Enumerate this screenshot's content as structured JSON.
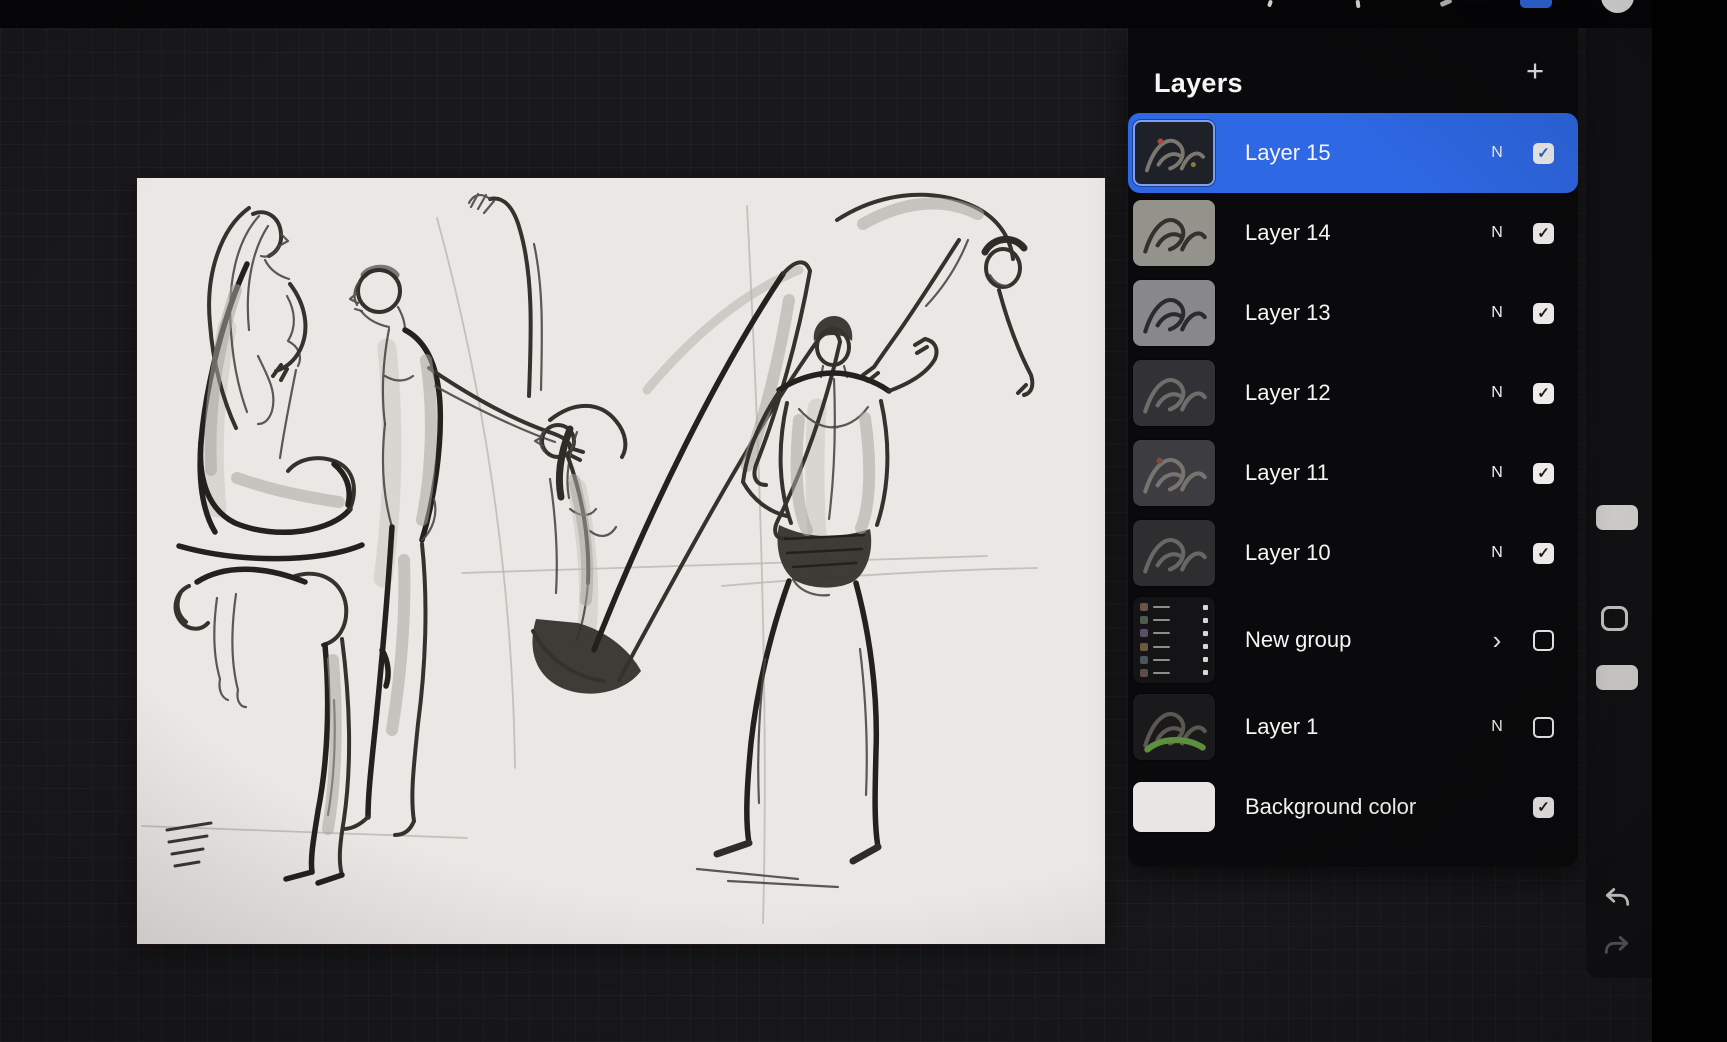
{
  "header": {
    "title": "Layers",
    "add_label": "+"
  },
  "layers": [
    {
      "name": "Layer 15",
      "blend": "N",
      "checked": true,
      "selected": true,
      "thumb": "l15"
    },
    {
      "name": "Layer 14",
      "blend": "N",
      "checked": true,
      "selected": false,
      "thumb": "light1"
    },
    {
      "name": "Layer 13",
      "blend": "N",
      "checked": true,
      "selected": false,
      "thumb": "light2"
    },
    {
      "name": "Layer 12",
      "blend": "N",
      "checked": true,
      "selected": false,
      "thumb": "dark1"
    },
    {
      "name": "Layer 11",
      "blend": "N",
      "checked": true,
      "selected": false,
      "thumb": "dark2"
    },
    {
      "name": "Layer 10",
      "blend": "N",
      "checked": true,
      "selected": false,
      "thumb": "dark3"
    },
    {
      "name": "New group",
      "group": true,
      "chevron_glyph": "›",
      "checked": false,
      "selected": false,
      "thumb": "group"
    },
    {
      "name": "Layer 1",
      "blend": "N",
      "checked": false,
      "selected": false,
      "thumb": "l1"
    },
    {
      "name": "Background color",
      "background": true,
      "checked": true,
      "selected": false,
      "thumb": "swatch"
    }
  ],
  "colors": {
    "selection_blue": "#2e68e4",
    "panel_bg": "#0a0a0c",
    "canvas_paper": "#e9e8e4",
    "toolbar_active_blue": "#2f6ae0"
  }
}
